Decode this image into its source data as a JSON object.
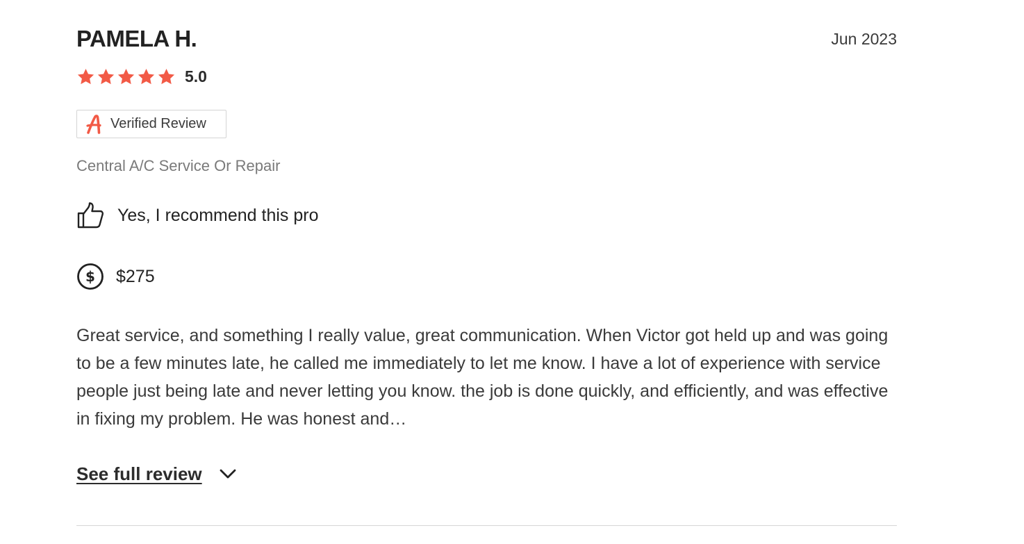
{
  "review": {
    "reviewer_name": "PAMELA H.",
    "date": "Jun 2023",
    "rating": {
      "value": "5.0",
      "stars": 5,
      "max_stars": 5,
      "star_color": "#f25a46"
    },
    "verified_badge": {
      "label": "Verified Review",
      "icon": "angi-logo-icon",
      "icon_color": "#f25a46"
    },
    "service_type": "Central A/C Service Or Repair",
    "recommend": {
      "icon": "thumbs-up-icon",
      "label": "Yes, I recommend this pro"
    },
    "cost": {
      "icon": "dollar-circle-icon",
      "label": "$275"
    },
    "body": "Great service, and something I really value, great communication. When Victor got held up and was going to be a few minutes late, he called me immediately to let me know. I have a lot of experience with service people just being late and never letting you know. the job is done quickly, and efficiently, and was effective in fixing my problem. He was honest and…",
    "see_full_review": {
      "label": "See full review",
      "icon": "chevron-down-icon"
    }
  }
}
